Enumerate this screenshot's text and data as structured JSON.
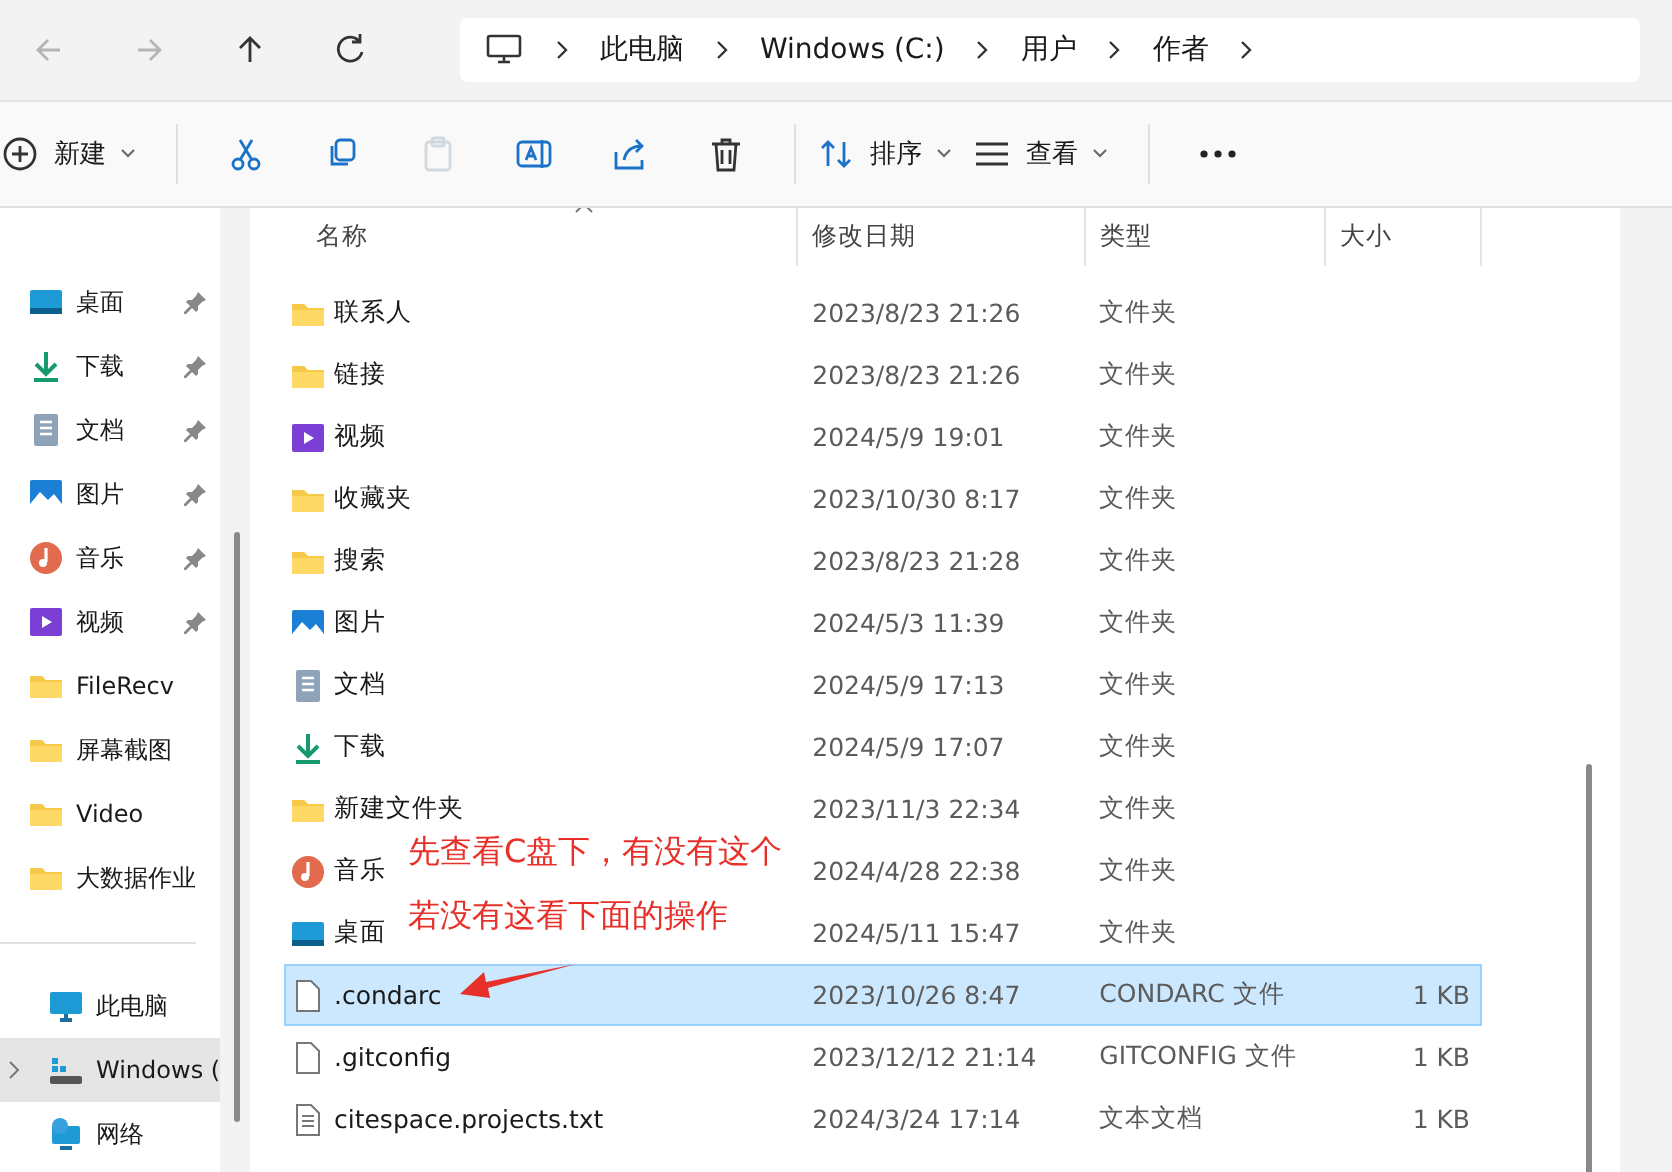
{
  "nav": {
    "buttons": [
      {
        "kind": "back",
        "disabled": true
      },
      {
        "kind": "forward",
        "disabled": true
      },
      {
        "kind": "up",
        "disabled": false
      },
      {
        "kind": "refresh",
        "disabled": false
      }
    ],
    "breadcrumb": [
      "此电脑",
      "Windows (C:)",
      "用户",
      "作者"
    ]
  },
  "toolbar": [
    {
      "kind": "new",
      "label": "新建",
      "disabled": false
    },
    {
      "kind": "cut",
      "disabled": false
    },
    {
      "kind": "copy",
      "disabled": false
    },
    {
      "kind": "paste",
      "disabled": true
    },
    {
      "kind": "rename",
      "disabled": false
    },
    {
      "kind": "share",
      "disabled": false
    },
    {
      "kind": "delete",
      "disabled": false
    },
    {
      "kind": "sort",
      "label": "排序",
      "disabled": false
    },
    {
      "kind": "view",
      "label": "查看",
      "disabled": false
    },
    {
      "kind": "more",
      "disabled": false
    }
  ],
  "sidebar": {
    "quick_access": [
      {
        "kind": "desktop",
        "label": "桌面",
        "pinned": true
      },
      {
        "kind": "download",
        "label": "下载",
        "pinned": true
      },
      {
        "kind": "document",
        "label": "文档",
        "pinned": true
      },
      {
        "kind": "picture",
        "label": "图片",
        "pinned": true
      },
      {
        "kind": "music",
        "label": "音乐",
        "pinned": true
      },
      {
        "kind": "video",
        "label": "视频",
        "pinned": true
      },
      {
        "kind": "folder",
        "label": "FileRecv",
        "pinned": false
      },
      {
        "kind": "folder",
        "label": "屏幕截图",
        "pinned": false
      },
      {
        "kind": "folder",
        "label": "Video",
        "pinned": false
      },
      {
        "kind": "folder",
        "label": "大数据作业",
        "pinned": false
      }
    ],
    "locations": [
      {
        "kind": "pc",
        "label": "此电脑",
        "selected": false,
        "expandable": false
      },
      {
        "kind": "drive",
        "label": "Windows (",
        "selected": true,
        "expandable": true
      },
      {
        "kind": "network",
        "label": "网络",
        "selected": false,
        "expandable": false
      }
    ]
  },
  "table": {
    "columns": [
      "名称",
      "修改日期",
      "类型",
      "大小"
    ],
    "rows": [
      {
        "kind": "folder",
        "name": "联系人",
        "modified": "2023/8/23 21:26",
        "type": "文件夹",
        "selected": false
      },
      {
        "kind": "folder",
        "name": "链接",
        "modified": "2023/8/23 21:26",
        "type": "文件夹",
        "selected": false
      },
      {
        "kind": "video",
        "name": "视频",
        "modified": "2024/5/9 19:01",
        "type": "文件夹",
        "selected": false
      },
      {
        "kind": "folder",
        "name": "收藏夹",
        "modified": "2023/10/30 8:17",
        "type": "文件夹",
        "selected": false
      },
      {
        "kind": "folder",
        "name": "搜索",
        "modified": "2023/8/23 21:28",
        "type": "文件夹",
        "selected": false
      },
      {
        "kind": "picture",
        "name": "图片",
        "modified": "2024/5/3 11:39",
        "type": "文件夹",
        "selected": false
      },
      {
        "kind": "document",
        "name": "文档",
        "modified": "2024/5/9 17:13",
        "type": "文件夹",
        "selected": false
      },
      {
        "kind": "download",
        "name": "下载",
        "modified": "2024/5/9 17:07",
        "type": "文件夹",
        "selected": false
      },
      {
        "kind": "folder",
        "name": "新建文件夹",
        "modified": "2023/11/3 22:34",
        "type": "文件夹",
        "selected": false
      },
      {
        "kind": "music",
        "name": "音乐",
        "modified": "2024/4/28 22:38",
        "type": "文件夹",
        "selected": false
      },
      {
        "kind": "desktop",
        "name": "桌面",
        "modified": "2024/5/11 15:47",
        "type": "文件夹",
        "selected": false
      },
      {
        "kind": "file",
        "name": ".condarc",
        "modified": "2023/10/26 8:47",
        "type": "CONDARC 文件",
        "size": "1 KB",
        "selected": true
      },
      {
        "kind": "file",
        "name": ".gitconfig",
        "modified": "2023/12/12 21:14",
        "type": "GITCONFIG 文件",
        "size": "1 KB",
        "selected": false
      },
      {
        "kind": "text",
        "name": "citespace.projects.txt",
        "modified": "2024/3/24 17:14",
        "type": "文本文档",
        "size": "1 KB",
        "selected": false
      }
    ]
  },
  "annotation": {
    "lines": [
      "先查看C盘下，有没有这个",
      "若没有这看下面的操作"
    ],
    "color": "#e8302a"
  }
}
